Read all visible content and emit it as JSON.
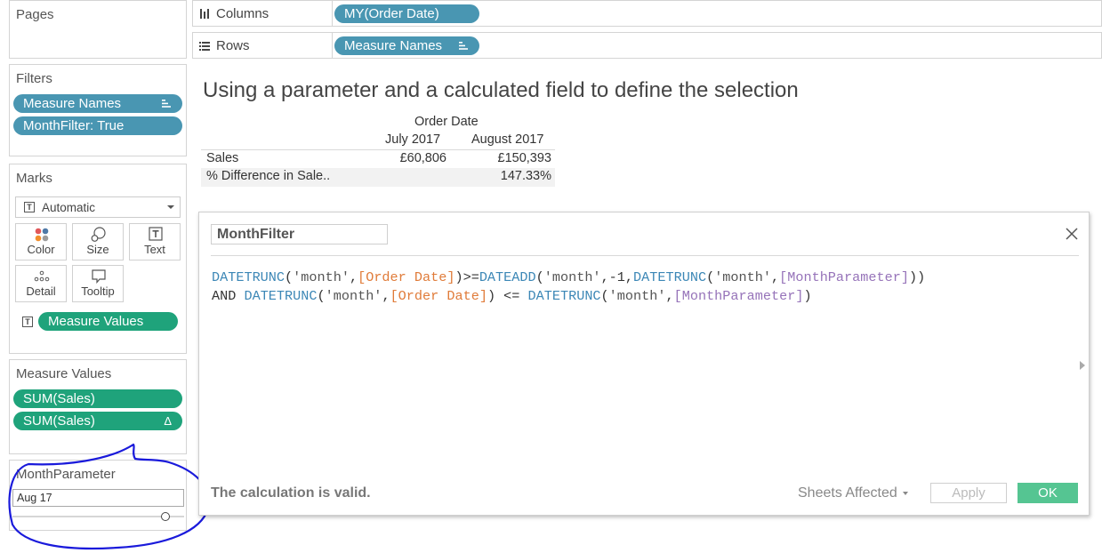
{
  "pages_card": {
    "title": "Pages"
  },
  "columns_shelf": {
    "icon": "columns-icon",
    "label": "Columns",
    "pill": "MY(Order Date)"
  },
  "rows_shelf": {
    "icon": "rows-icon",
    "label": "Rows",
    "pill": "Measure Names"
  },
  "filters_card": {
    "title": "Filters",
    "pills": [
      {
        "label": "Measure Names",
        "icon": "sort-icon"
      },
      {
        "label": "MonthFilter: True"
      }
    ]
  },
  "marks_card": {
    "title": "Marks",
    "mark_type": "Automatic",
    "buttons": [
      {
        "label": "Color",
        "icon": "color-icon"
      },
      {
        "label": "Size",
        "icon": "size-icon"
      },
      {
        "label": "Text",
        "icon": "text-icon"
      },
      {
        "label": "Detail",
        "icon": "detail-icon"
      },
      {
        "label": "Tooltip",
        "icon": "tooltip-icon"
      }
    ],
    "measure_pill": "Measure Values"
  },
  "measure_values_card": {
    "title": "Measure Values",
    "pills": [
      {
        "label": "SUM(Sales)"
      },
      {
        "label": "SUM(Sales)",
        "delta": "Δ"
      }
    ]
  },
  "parameter_card": {
    "title": "MonthParameter",
    "value": "Aug 17"
  },
  "view": {
    "title": "Using a parameter and a calculated field to define the selection",
    "table": {
      "column_group": "Order Date",
      "columns": [
        "July 2017",
        "August 2017"
      ],
      "rows": [
        {
          "label": "Sales",
          "values": [
            "£60,806",
            "£150,393"
          ]
        },
        {
          "label": "% Difference in Sale..",
          "values": [
            "",
            "147.33%"
          ]
        }
      ]
    }
  },
  "calc_dialog": {
    "name": "MonthFilter",
    "close_icon": "close-icon",
    "code_line1": [
      {
        "t": "DATETRUNC",
        "k": "fn"
      },
      {
        "t": "(",
        "k": "op"
      },
      {
        "t": "'month'",
        "k": "str"
      },
      {
        "t": ",",
        "k": "op"
      },
      {
        "t": "[Order Date]",
        "k": "fld"
      },
      {
        "t": ")>=",
        "k": "op"
      },
      {
        "t": "DATEADD",
        "k": "fn"
      },
      {
        "t": "(",
        "k": "op"
      },
      {
        "t": "'month'",
        "k": "str"
      },
      {
        "t": ",-1,",
        "k": "op"
      },
      {
        "t": "DATETRUNC",
        "k": "fn"
      },
      {
        "t": "(",
        "k": "op"
      },
      {
        "t": "'month'",
        "k": "str"
      },
      {
        "t": ",",
        "k": "op"
      },
      {
        "t": "[MonthParameter]",
        "k": "par"
      },
      {
        "t": "))",
        "k": "op"
      }
    ],
    "code_line2": [
      {
        "t": "AND ",
        "k": "op"
      },
      {
        "t": "DATETRUNC",
        "k": "fn"
      },
      {
        "t": "(",
        "k": "op"
      },
      {
        "t": "'month'",
        "k": "str"
      },
      {
        "t": ",",
        "k": "op"
      },
      {
        "t": "[Order Date]",
        "k": "fld"
      },
      {
        "t": ") <= ",
        "k": "op"
      },
      {
        "t": "DATETRUNC",
        "k": "fn"
      },
      {
        "t": "(",
        "k": "op"
      },
      {
        "t": "'month'",
        "k": "str"
      },
      {
        "t": ",",
        "k": "op"
      },
      {
        "t": "[MonthParameter]",
        "k": "par"
      },
      {
        "t": ")",
        "k": "op"
      }
    ],
    "status": "The calculation is valid.",
    "sheets_affected": "Sheets Affected",
    "apply_label": "Apply",
    "ok_label": "OK"
  },
  "colors": {
    "dimension_pill": "#4996b2",
    "measure_pill": "#1fa37b",
    "annotation_circle": "#1a1adb"
  }
}
